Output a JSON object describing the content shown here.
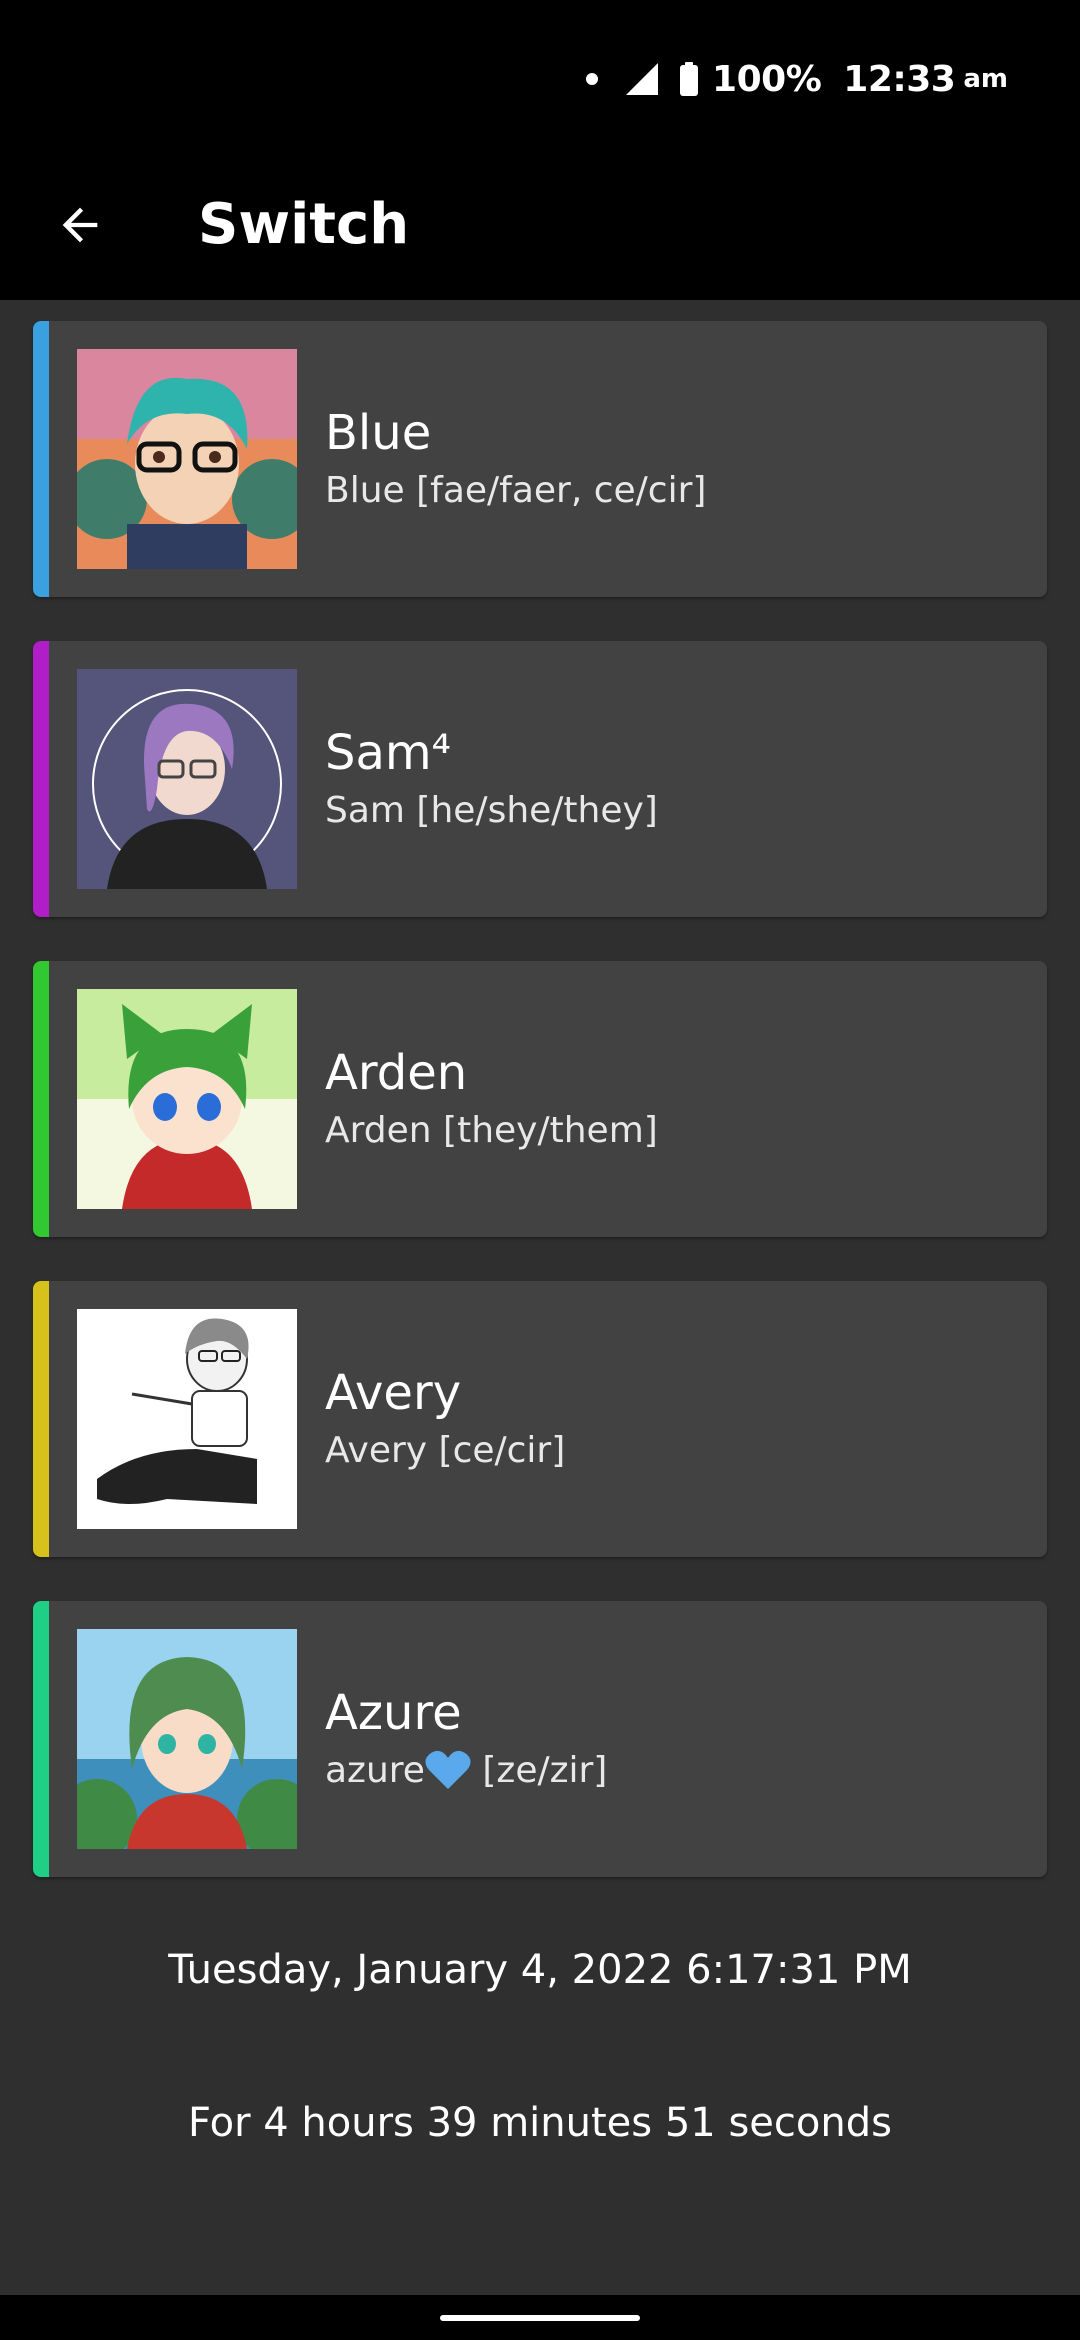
{
  "status_bar": {
    "battery": "100%",
    "time": "12:33",
    "ampm": "am"
  },
  "app_bar": {
    "title": "Switch",
    "back_icon": "arrow-left-icon"
  },
  "members": [
    {
      "name": "Blue",
      "subtitle": "Blue [fae/faer, ce/cir]",
      "color": "#3aa0e0"
    },
    {
      "name": "Sam⁴",
      "subtitle": "Sam [he/she/they]",
      "color": "#b01ec8"
    },
    {
      "name": "Arden",
      "subtitle": "Arden [they/them]",
      "color": "#32c832"
    },
    {
      "name": "Avery",
      "subtitle": "Avery [ce/cir]",
      "color": "#d6c21a"
    },
    {
      "name": "Azure",
      "subtitle_prefix": "azure",
      "subtitle_suffix": " [ze/zir]",
      "color": "#1fcf86"
    }
  ],
  "switch_info": {
    "date": "Tuesday, January 4, 2022 6:17:31 PM",
    "duration": "For 4 hours 39 minutes 51 seconds"
  },
  "colors": {
    "background": "#2f2f2f",
    "card": "#424242",
    "bar": "#000000"
  }
}
